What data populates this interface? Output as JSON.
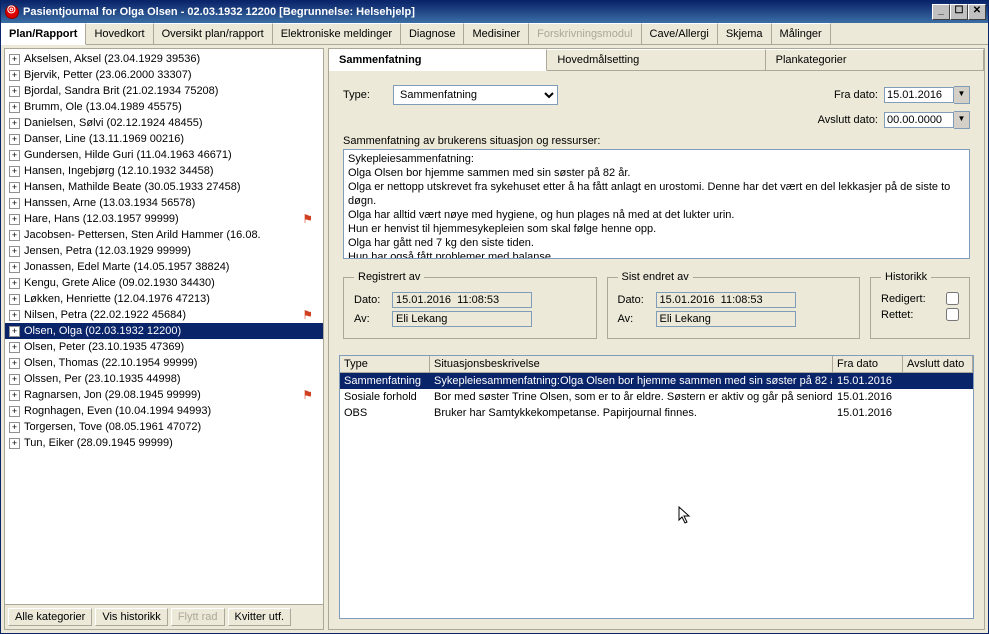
{
  "window": {
    "title": "Pasientjournal for Olga Olsen - 02.03.1932 12200   [Begrunnelse: Helsehjelp]",
    "btn_min": "_",
    "btn_max": "☐",
    "btn_close": "✕"
  },
  "menubar": [
    "Plan/Rapport",
    "Hovedkort",
    "Oversikt plan/rapport",
    "Elektroniske meldinger",
    "Diagnose",
    "Medisiner",
    "Forskrivningsmodul",
    "Cave/Allergi",
    "Skjema",
    "Målinger"
  ],
  "patients": [
    {
      "label": "Akselsen, Aksel (23.04.1929 39536)",
      "flag": false
    },
    {
      "label": "Bjervik, Petter (23.06.2000 33307)",
      "flag": false
    },
    {
      "label": "Bjordal, Sandra Brit (21.02.1934 75208)",
      "flag": false
    },
    {
      "label": "Brumm, Ole (13.04.1989 45575)",
      "flag": false
    },
    {
      "label": "Danielsen, Sølvi (02.12.1924 48455)",
      "flag": false
    },
    {
      "label": "Danser, Line (13.11.1969 00216)",
      "flag": false
    },
    {
      "label": "Gundersen, Hilde Guri (11.04.1963 46671)",
      "flag": false
    },
    {
      "label": "Hansen, Ingebjørg (12.10.1932 34458)",
      "flag": false
    },
    {
      "label": "Hansen, Mathilde Beate (30.05.1933 27458)",
      "flag": false
    },
    {
      "label": "Hanssen, Arne (13.03.1934 56578)",
      "flag": false
    },
    {
      "label": "Hare, Hans (12.03.1957 99999)",
      "flag": true
    },
    {
      "label": "Jacobsen- Pettersen, Sten Arild Hammer (16.08.",
      "flag": false
    },
    {
      "label": "Jensen, Petra (12.03.1929 99999)",
      "flag": false
    },
    {
      "label": "Jonassen, Edel Marte (14.05.1957 38824)",
      "flag": false
    },
    {
      "label": "Kengu, Grete Alice (09.02.1930 34430)",
      "flag": false
    },
    {
      "label": "Løkken, Henriette (12.04.1976 47213)",
      "flag": false
    },
    {
      "label": "Nilsen, Petra (22.02.1922 45684)",
      "flag": true
    },
    {
      "label": "Olsen, Olga (02.03.1932 12200)",
      "flag": false,
      "selected": true
    },
    {
      "label": "Olsen, Peter (23.10.1935 47369)",
      "flag": false
    },
    {
      "label": "Olsen, Thomas (22.10.1954 99999)",
      "flag": false
    },
    {
      "label": "Olssen, Per (23.10.1935 44998)",
      "flag": false
    },
    {
      "label": "Ragnarsen, Jon (29.08.1945 99999)",
      "flag": true
    },
    {
      "label": "Rognhagen, Even (10.04.1994 94993)",
      "flag": false
    },
    {
      "label": "Torgersen, Tove (08.05.1961 47072)",
      "flag": false
    },
    {
      "label": "Tun, Eiker (28.09.1945 99999)",
      "flag": false
    }
  ],
  "left_buttons": {
    "alle": "Alle kategorier",
    "vis": "Vis historikk",
    "flytt": "Flytt rad",
    "kvitter": "Kvitter utf."
  },
  "right_tabs": [
    "Sammenfatning",
    "Hovedmålsetting",
    "Plankategorier"
  ],
  "form": {
    "type_label": "Type:",
    "type_value": "Sammenfatning",
    "fra_label": "Fra dato:",
    "fra_value": "15.01.2016",
    "avslutt_label": "Avslutt dato:",
    "avslutt_value": "00.00.0000",
    "situasjon_label": "Sammenfatning av brukerens situasjon og ressurser:",
    "textblock": {
      "l1": "Sykepleiesammenfatning:",
      "l2": "Olga Olsen bor hjemme sammen med sin søster på 82 år.",
      "l3": "Olga er nettopp utskrevet fra sykehuset etter å ha fått anlagt en urostomi. Denne har det vært en del lekkasjer på de siste to døgn.",
      "l4": "Olga har alltid vært nøye med hygiene, og hun plages nå med at det lukter urin.",
      "l5": "Hun er henvist til hjemmesykepleien som skal følge henne opp.",
      "l6": "Olga har gått ned 7 kg den siste tiden.",
      "l7": "Hun har også fått problemer med balanse."
    },
    "registrert_legend": "Registrert av",
    "sist_legend": "Sist endret av",
    "historikk_legend": "Historikk",
    "dato_label": "Dato:",
    "av_label": "Av:",
    "dato_value": "15.01.2016  11:08:53",
    "av_value": "Eli Lekang",
    "redigert_label": "Redigert:",
    "rettet_label": "Rettet:"
  },
  "grid": {
    "headers": {
      "type": "Type",
      "desc": "Situasjonsbeskrivelse",
      "fra": "Fra dato",
      "avslutt": "Avslutt dato"
    },
    "rows": [
      {
        "type": "Sammenfatning",
        "desc": "Sykepleiesammenfatning:Olga Olsen bor hjemme sammen med sin søster på 82 å",
        "fra": "15.01.2016",
        "avslutt": "",
        "sel": true
      },
      {
        "type": "Sosiale forhold",
        "desc": "Bor med søster Trine Olsen, som er to år eldre. Søstern er aktiv og går på seniord",
        "fra": "15.01.2016",
        "avslutt": "",
        "sel": false
      },
      {
        "type": "OBS",
        "desc": "Bruker har Samtykkekompetanse. Papirjournal finnes.",
        "fra": "15.01.2016",
        "avslutt": "",
        "sel": false
      }
    ]
  }
}
